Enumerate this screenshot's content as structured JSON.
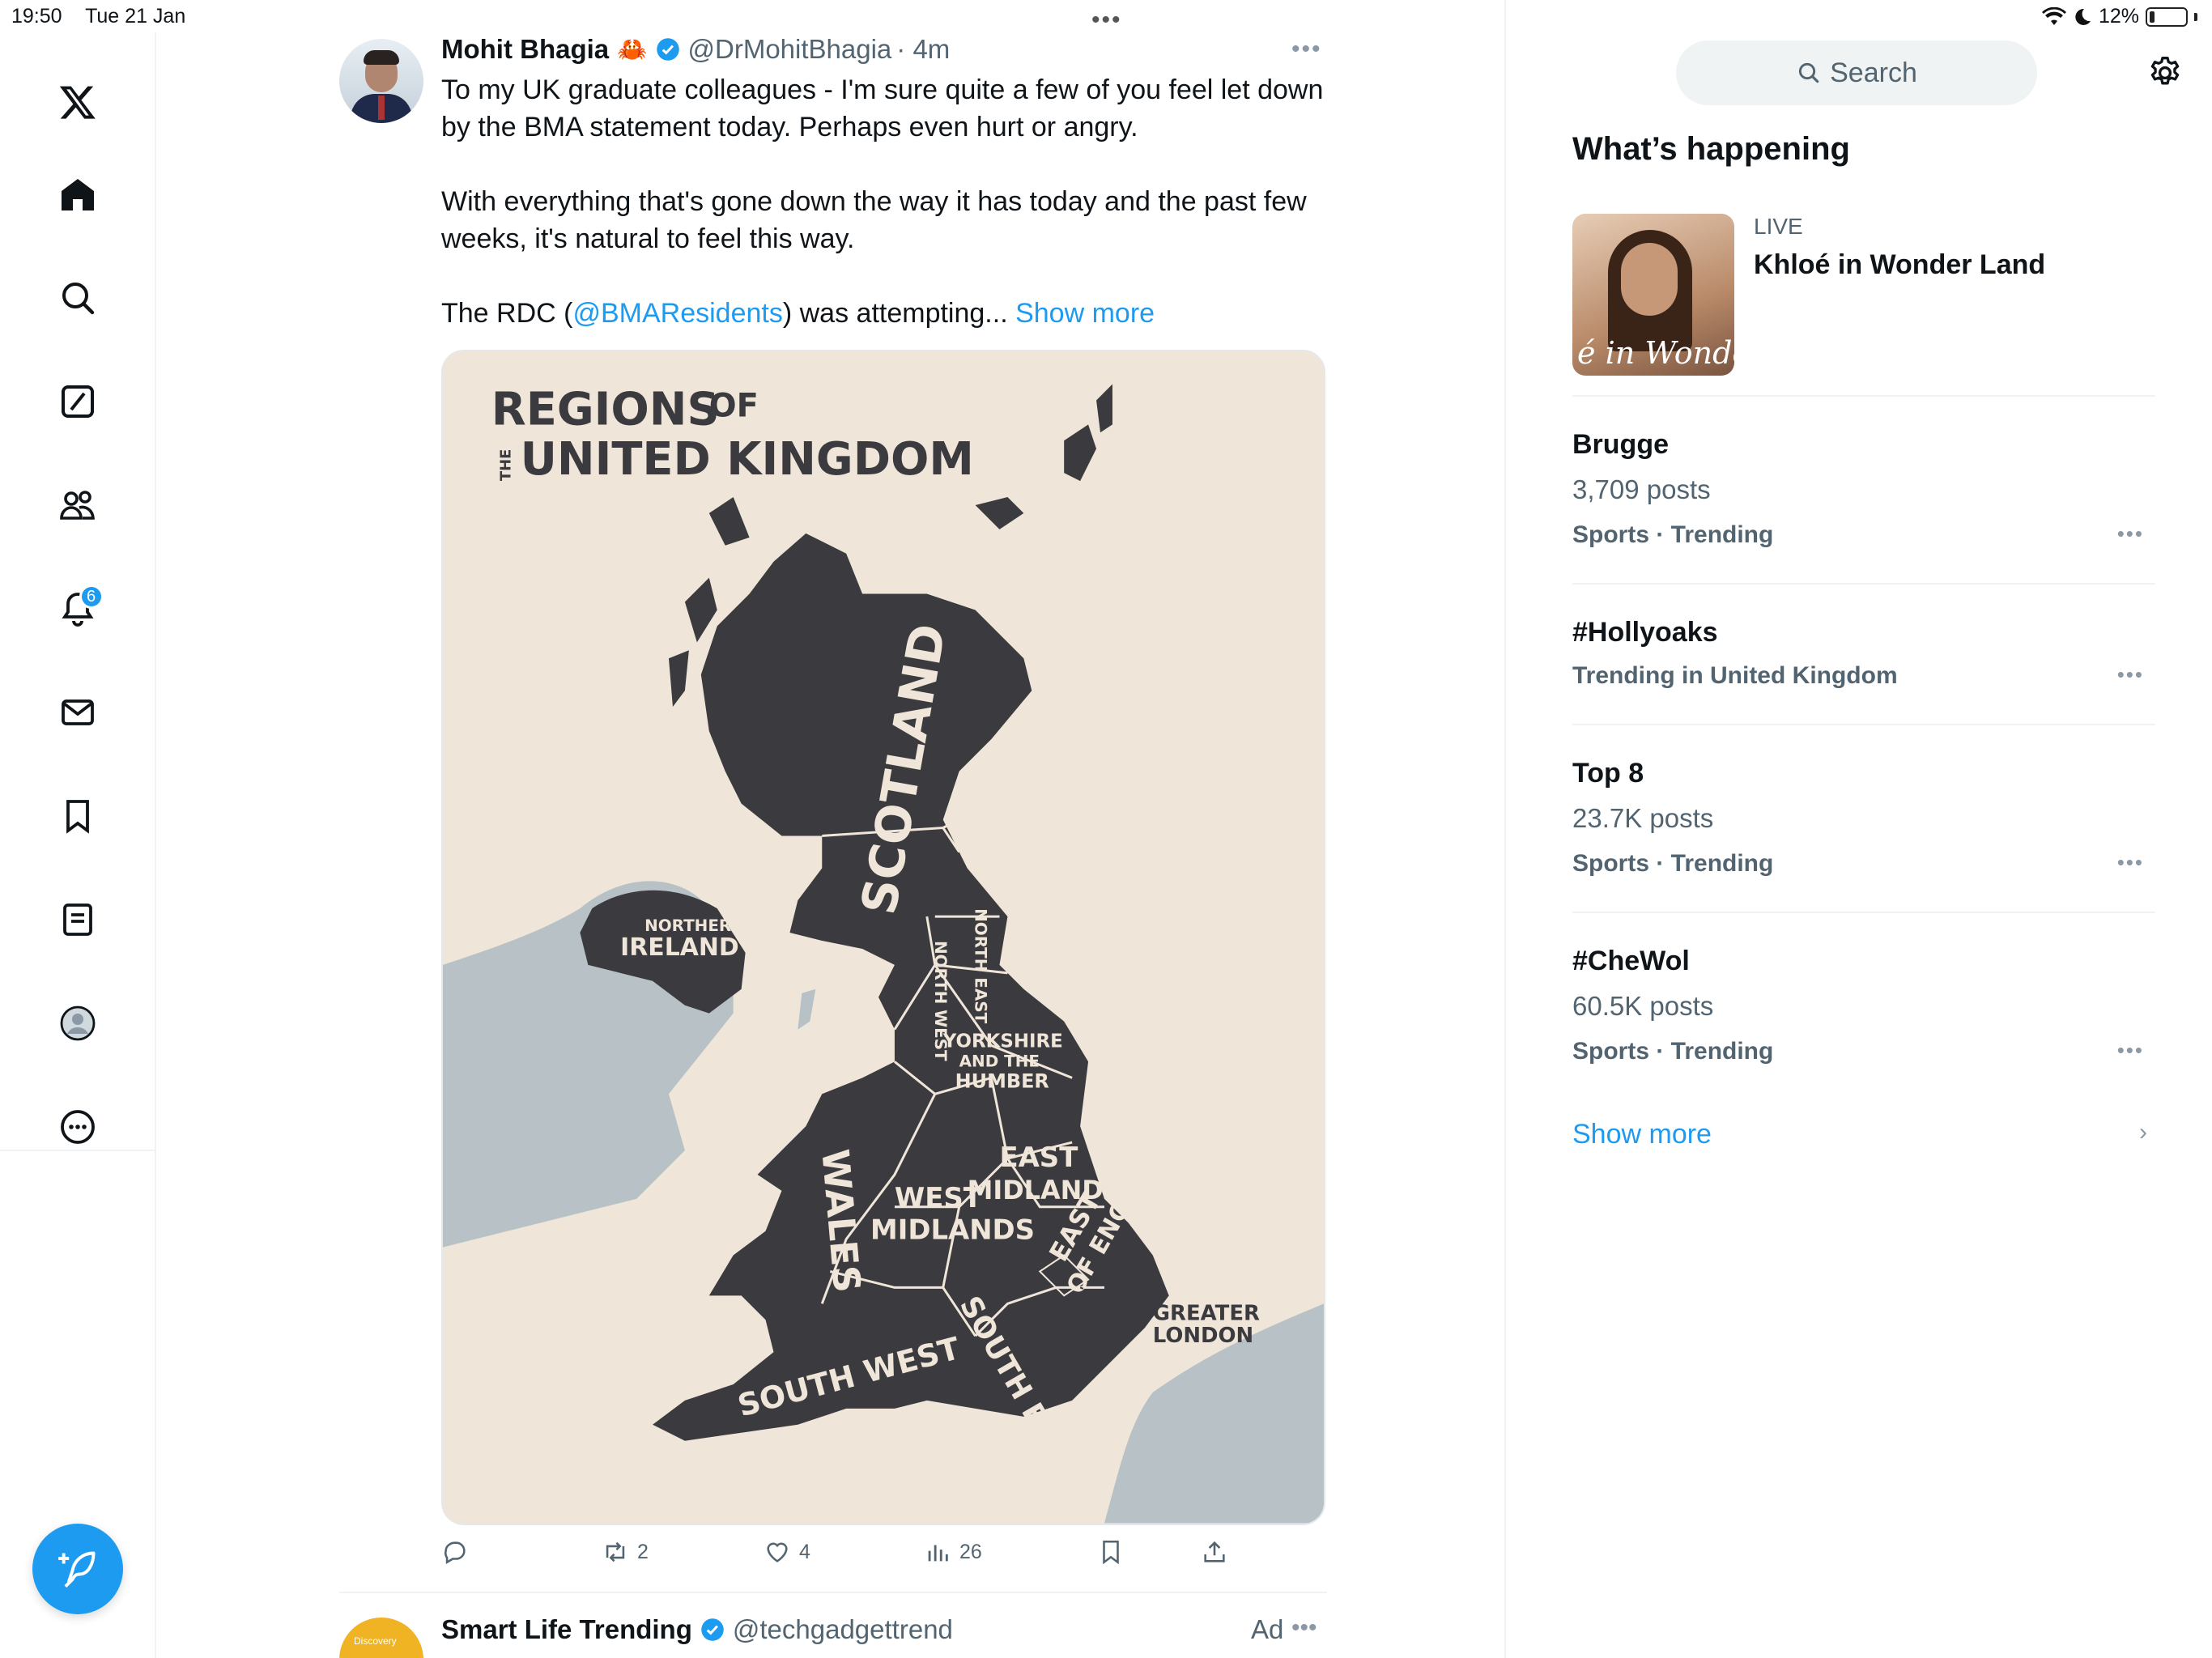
{
  "status_bar": {
    "time": "19:50",
    "date": "Tue 21 Jan",
    "battery": "12%"
  },
  "nav": {
    "notifications_badge": "6"
  },
  "tweet": {
    "name": "Mohit Bhagia",
    "handle": "@DrMohitBhagia",
    "time": "· 4m",
    "paragraph1": "To my UK graduate colleagues - I'm sure quite a few of you feel let down by the BMA statement today. Perhaps even hurt or angry.",
    "paragraph2": "With everything that's gone down the way it has today and the past few weeks, it's natural to feel this way.",
    "paragraph3_prefix": "The RDC (",
    "mention": "@BMAResidents",
    "paragraph3_suffix": ") was attempting...",
    "show_more": "Show more",
    "map": {
      "title_line1": "REGIONS",
      "title_of": "OF",
      "title_the": "THE",
      "title_line2": "UNITED KINGDOM",
      "regions": {
        "scotland": "SCOTLAND",
        "northern_ireland_1": "NORTHERN",
        "northern_ireland_2": "IRELAND",
        "north_east": "NORTH EAST",
        "north_west": "NORTH WEST",
        "yorkshire_1": "YORKSHIRE",
        "yorkshire_2": "AND THE",
        "yorkshire_3": "HUMBER",
        "wales": "WALES",
        "west_midlands_1": "WEST",
        "west_midlands_2": "MIDLANDS",
        "east_midlands_1": "EAST",
        "east_midlands_2": "MIDLANDS",
        "east_of_england_1": "EAST",
        "east_of_england_2": "OF ENGLAND",
        "greater_london_1": "GREATER",
        "greater_london_2": "LONDON",
        "south_west": "SOUTH WEST",
        "south_east": "SOUTH EAST"
      }
    },
    "actions": {
      "retweets": "2",
      "likes": "4",
      "views": "26"
    }
  },
  "next_tweet": {
    "name": "Smart Life Trending",
    "handle": "@techgadgettrend",
    "ad_label": "Ad",
    "avatar_text": "Discovery"
  },
  "sidebar": {
    "search_placeholder": "Search",
    "section_title": "What’s happening",
    "live": {
      "label": "LIVE",
      "title": "Khloé in Wonder Land",
      "thumb_text": "é in Wonder L"
    },
    "trends": [
      {
        "name": "Brugge",
        "posts": "3,709 posts",
        "meta": "Sports · Trending"
      },
      {
        "name": "#Hollyoaks",
        "posts": "",
        "meta": "Trending in United Kingdom"
      },
      {
        "name": "Top 8",
        "posts": "23.7K posts",
        "meta": "Sports · Trending"
      },
      {
        "name": "#CheWol",
        "posts": "60.5K posts",
        "meta": "Sports · Trending"
      }
    ],
    "show_more": "Show more"
  },
  "colors": {
    "accent": "#1d9bf0",
    "map_land": "#3b3a3e",
    "map_sea_land": "#b7c1c6",
    "map_background": "#efe6d9"
  }
}
